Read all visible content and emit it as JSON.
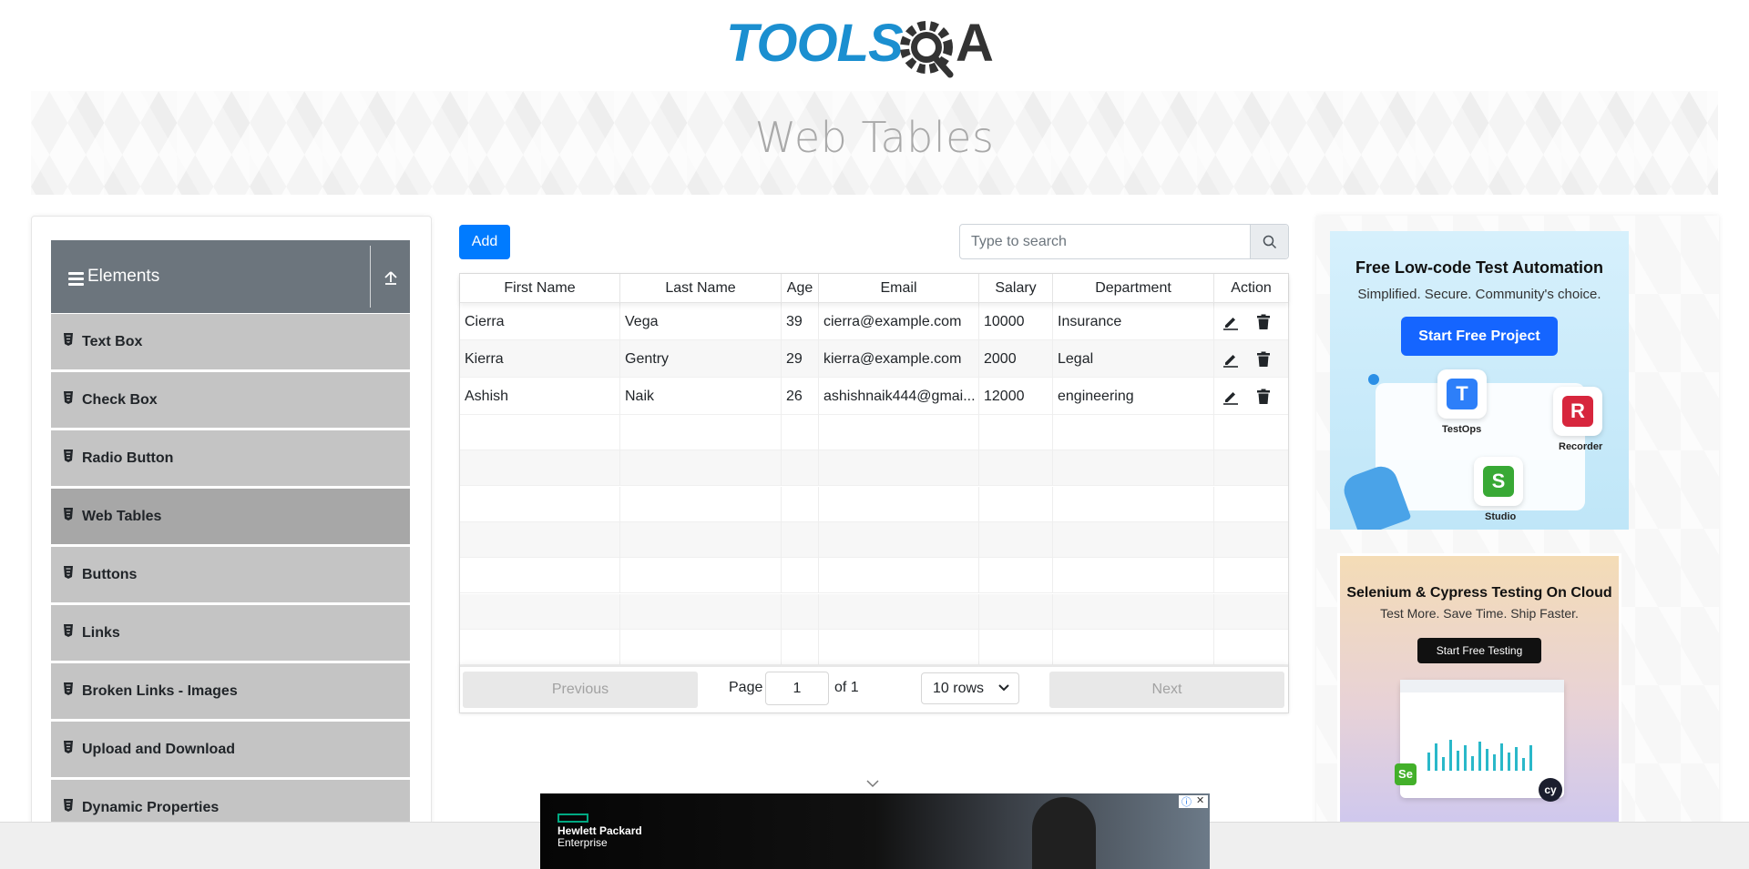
{
  "header": {
    "logo_text": "TOOLSQA",
    "page_title": "Web Tables"
  },
  "sidebar": {
    "group_title": "Elements",
    "items": [
      {
        "label": "Text Box"
      },
      {
        "label": "Check Box"
      },
      {
        "label": "Radio Button"
      },
      {
        "label": "Web Tables",
        "active": true
      },
      {
        "label": "Buttons"
      },
      {
        "label": "Links"
      },
      {
        "label": "Broken Links - Images"
      },
      {
        "label": "Upload and Download"
      },
      {
        "label": "Dynamic Properties"
      }
    ]
  },
  "toolbar": {
    "add_label": "Add",
    "search_placeholder": "Type to search"
  },
  "table": {
    "columns": [
      "First Name",
      "Last Name",
      "Age",
      "Email",
      "Salary",
      "Department",
      "Action"
    ],
    "rows": [
      [
        "Cierra",
        "Vega",
        "39",
        "cierra@example.com",
        "10000",
        "Insurance"
      ],
      [
        "Kierra",
        "Gentry",
        "29",
        "kierra@example.com",
        "2000",
        "Legal"
      ],
      [
        "Ashish",
        "Naik",
        "26",
        "ashishnaik444@gmai...",
        "12000",
        "engineering"
      ]
    ],
    "empty_rows": 7
  },
  "pagination": {
    "previous_label": "Previous",
    "next_label": "Next",
    "page_label": "Page",
    "page_value": "1",
    "of_label": "of 1",
    "rows_label": "10 rows"
  },
  "ads": {
    "ad1": {
      "headline": "Free Low-code Test Automation",
      "subline": "Simplified. Secure. Community's choice.",
      "cta": "Start Free Project",
      "labels": [
        "TestOps",
        "Recorder",
        "Studio"
      ]
    },
    "ad2": {
      "headline": "Selenium & Cypress Testing On Cloud",
      "subline": "Test More. Save Time. Ship Faster.",
      "cta": "Start Free Testing"
    },
    "bottom": {
      "brand_line1": "Hewlett Packard",
      "brand_line2": "Enterprise"
    }
  },
  "colors": {
    "primary": "#007bff",
    "menu_header": "#6c757d",
    "menu_item": "#c4c4c4",
    "menu_active": "#a7a7a7",
    "logo_blue": "#1b8fd0"
  }
}
